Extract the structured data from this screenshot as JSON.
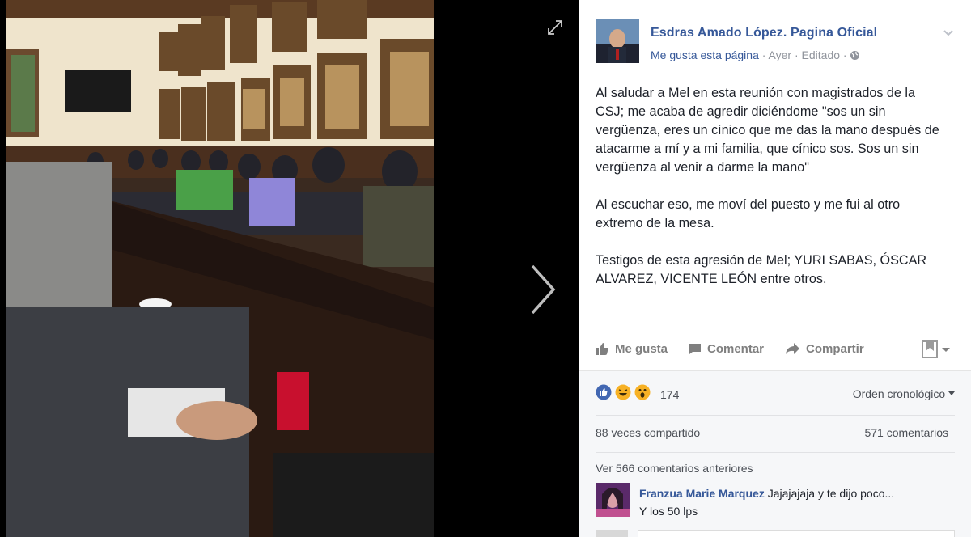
{
  "post": {
    "page_name": "Esdras Amado López. Pagina Oficial",
    "like_page": "Me gusta esta página",
    "separator": " · ",
    "time": "Ayer",
    "edited": "Editado",
    "paragraphs": [
      "Al saludar a Mel en esta reunión con magistrados de la CSJ; me acaba de agredir diciéndome \"sos un sin vergüenza, eres un cínico que me das la mano después de atacarme a mí y a mi familia, que cínico sos. Sos un sin vergüenza al venir a darme la mano\"",
      "Al escuchar eso, me moví del puesto y me fui al otro extremo de la mesa.",
      "Testigos de esta agresión de Mel; YURI SABAS, ÓSCAR ALVAREZ, VICENTE LEÓN entre otros."
    ]
  },
  "actions": {
    "like": "Me gusta",
    "comment": "Comentar",
    "share": "Compartir"
  },
  "stats": {
    "reactions_count": "174",
    "order": "Orden cronológico",
    "shares": "88 veces compartido",
    "comments": "571 comentarios",
    "view_previous": "Ver 566 comentarios anteriores"
  },
  "comment": {
    "author": "Franzua Marie Marquez",
    "text_line1": "Jajajajaja y te dijo poco...",
    "text_line2": "Y los 50 lps"
  },
  "colors": {
    "link_blue": "#365899",
    "like_blue": "#4267b2",
    "haha_yellow": "#f7b125"
  }
}
